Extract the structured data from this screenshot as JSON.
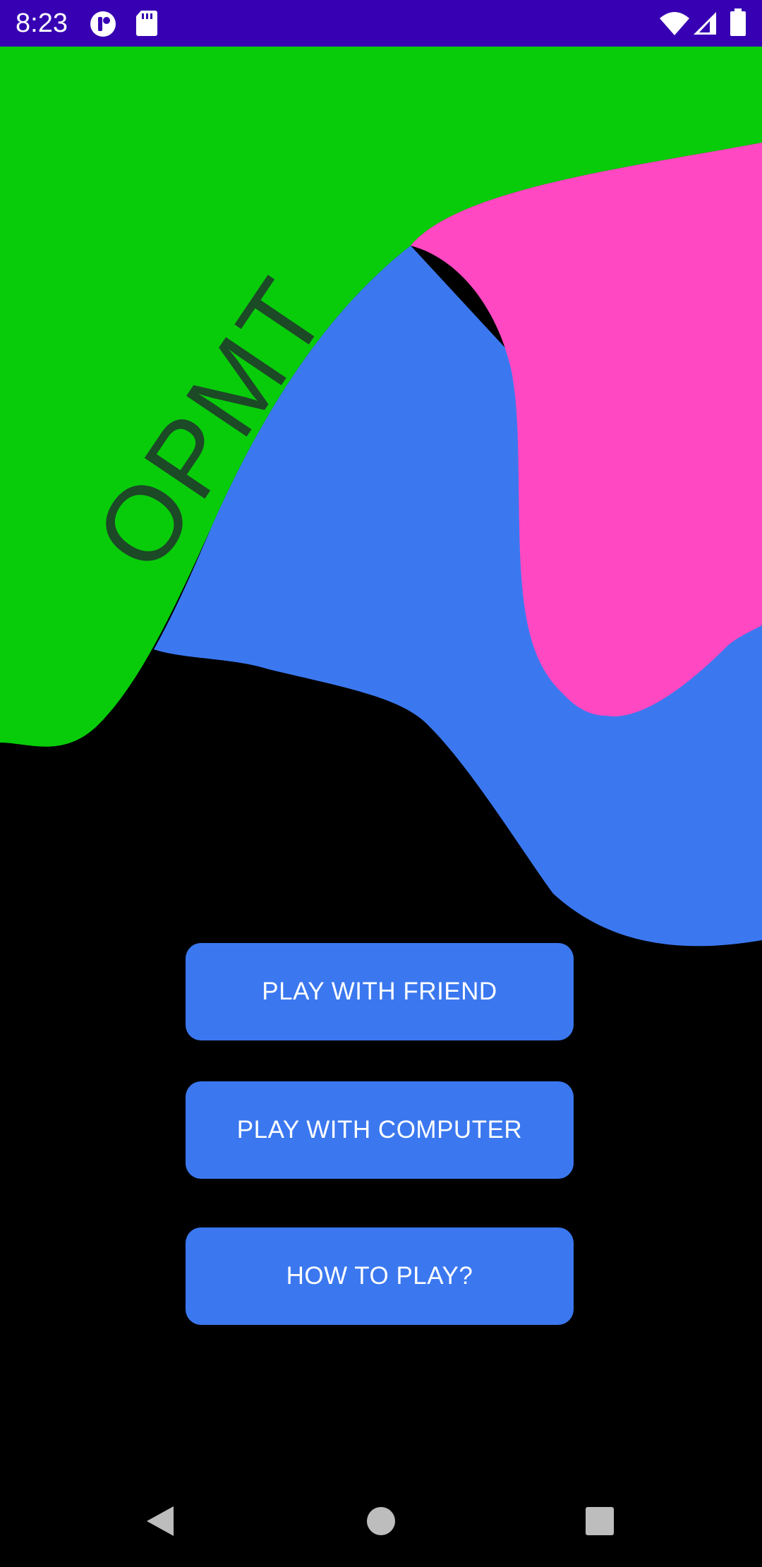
{
  "status_bar": {
    "time": "8:23",
    "icons": [
      "notification-app-icon",
      "sd-card-icon",
      "wifi-icon",
      "cellular-signal-icon",
      "battery-icon"
    ],
    "background": "#3700b3"
  },
  "hero": {
    "logo_text": "OPMT",
    "colors": {
      "green": "#08cc0a",
      "pink": "#ff48c1",
      "blue": "#3b78f0"
    }
  },
  "menu": {
    "play_friend_label": "PLAY WITH FRIEND",
    "play_computer_label": "PLAY WITH COMPUTER",
    "how_to_play_label": "HOW TO PLAY?",
    "button_color": "#3b78f0"
  },
  "nav_bar": {
    "items": [
      "back-icon",
      "home-icon",
      "recents-icon"
    ]
  }
}
